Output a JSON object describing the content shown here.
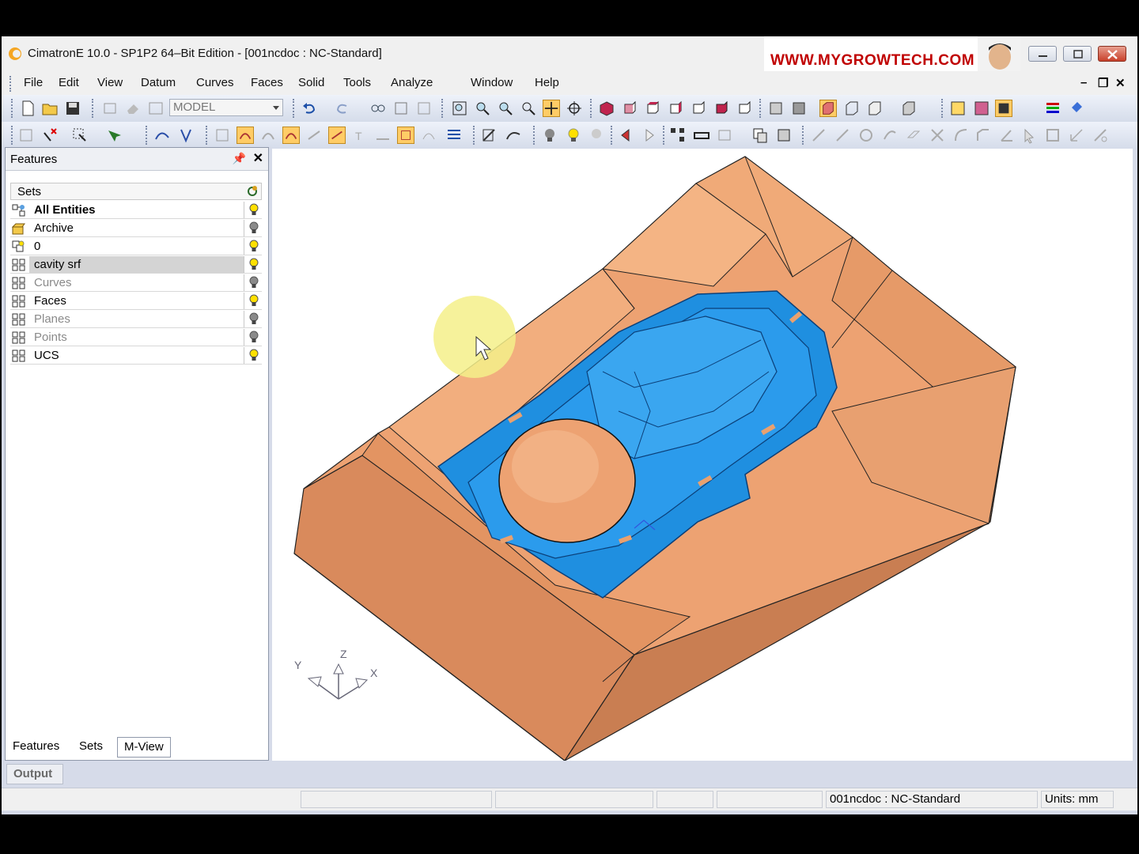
{
  "window": {
    "title": "CimatronE 10.0 - SP1P2 64–Bit Edition - [001ncdoc : NC-Standard]"
  },
  "brand": {
    "url": "WWW.MYGROWTECH.COM"
  },
  "menu": {
    "items": [
      "File",
      "Edit",
      "View",
      "Datum",
      "Curves",
      "Faces",
      "Solid",
      "Tools",
      "Analyze",
      "Window",
      "Help"
    ]
  },
  "toolbar": {
    "mode_combo_value": "MODEL"
  },
  "features_panel": {
    "title": "Features",
    "sets_header": "Sets",
    "rows": [
      {
        "label": "All Entities",
        "style": "bold",
        "bulb": "on",
        "icon": "all-entities-icon"
      },
      {
        "label": "Archive",
        "style": "normal",
        "bulb": "off",
        "icon": "archive-icon"
      },
      {
        "label": "0",
        "style": "normal",
        "bulb": "on",
        "icon": "layer-icon"
      },
      {
        "label": "cavity srf",
        "style": "normal",
        "bulb": "on",
        "icon": "set-icon",
        "selected": true
      },
      {
        "label": "Curves",
        "style": "dim",
        "bulb": "off",
        "icon": "set-icon"
      },
      {
        "label": "Faces",
        "style": "normal",
        "bulb": "on",
        "icon": "set-icon"
      },
      {
        "label": "Planes",
        "style": "dim",
        "bulb": "off",
        "icon": "set-icon"
      },
      {
        "label": "Points",
        "style": "dim",
        "bulb": "off",
        "icon": "set-icon"
      },
      {
        "label": "UCS",
        "style": "normal",
        "bulb": "on",
        "icon": "set-icon"
      }
    ],
    "bottom_tabs": [
      "Features",
      "Sets",
      "M-View"
    ],
    "active_tab": "M-View"
  },
  "output_label": "Output",
  "triad": {
    "x": "X",
    "y": "Y",
    "z": "Z"
  },
  "status": {
    "document": "001ncdoc : NC-Standard",
    "units": "Units: mm"
  },
  "colors": {
    "part_orange": "#e99c66",
    "cavity_blue": "#1f8fe0",
    "bulb_on": "#ffe000",
    "bulb_off": "#8a8a8a",
    "cursor_highlight": "#f5f08a"
  }
}
